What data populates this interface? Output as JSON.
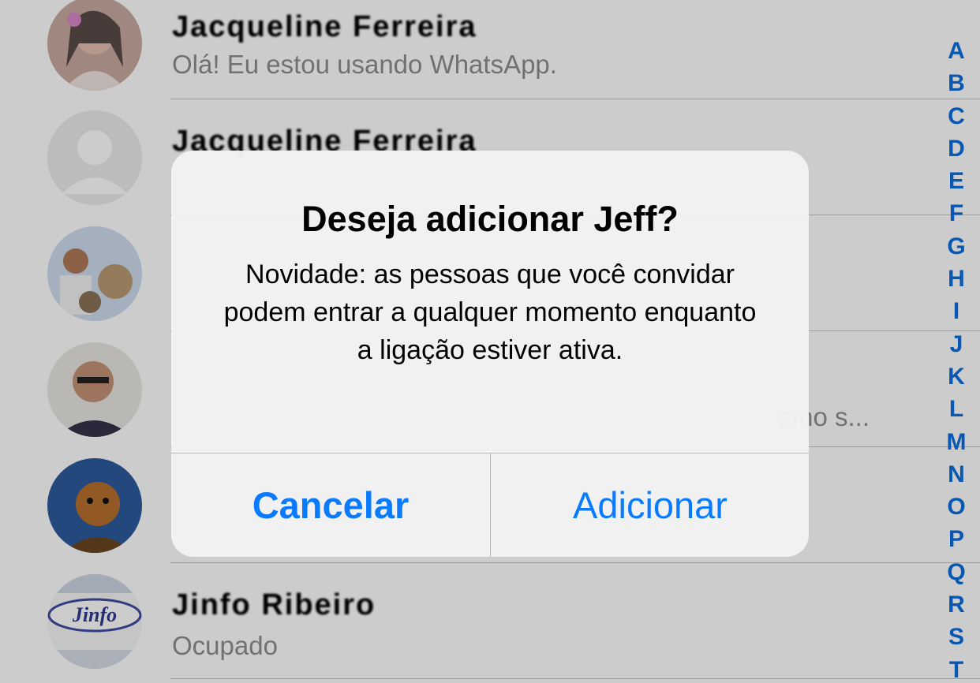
{
  "contacts": [
    {
      "name": "Jacqueline Ferreira",
      "status": "Olá! Eu estou usando WhatsApp."
    },
    {
      "name": "Jacqueline Ferreira",
      "status": ""
    },
    {
      "name": "",
      "status": ""
    },
    {
      "name": "",
      "status": "smo s..."
    },
    {
      "name": "",
      "status": ""
    },
    {
      "name": "Jinfo Ribeiro",
      "status": "Ocupado"
    }
  ],
  "avatar_labels": {
    "jinfo": "Jinfo"
  },
  "index_letters": [
    "A",
    "B",
    "C",
    "D",
    "E",
    "F",
    "G",
    "H",
    "I",
    "J",
    "K",
    "L",
    "M",
    "N",
    "O",
    "P",
    "Q",
    "R",
    "S",
    "T"
  ],
  "alert": {
    "title": "Deseja adicionar Jeff?",
    "message": "Novidade: as pessoas que você convidar podem entrar a qualquer momento enquanto a ligação estiver ativa.",
    "cancel_label": "Cancelar",
    "add_label": "Adicionar"
  },
  "colors": {
    "accent": "#0a7aff",
    "index": "#0a6fe0",
    "status_text": "#8e8e93"
  }
}
